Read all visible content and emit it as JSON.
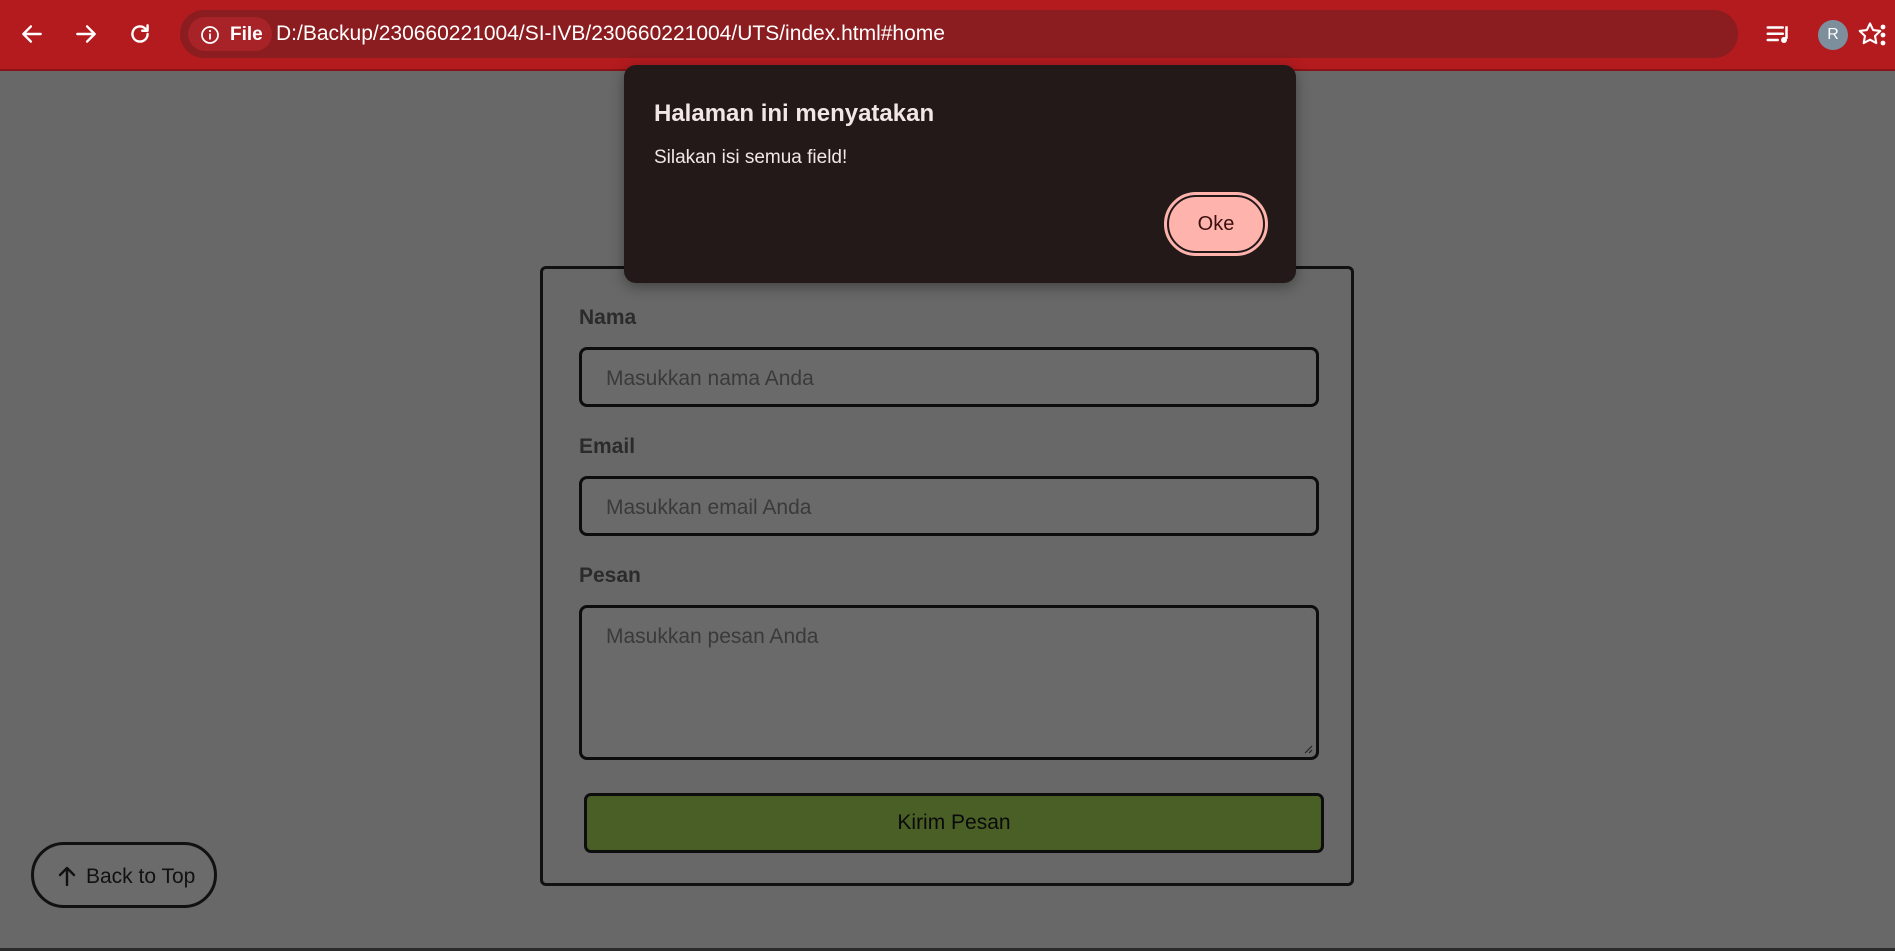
{
  "browser": {
    "site_info_label": "File",
    "url": "D:/Backup/230660221004/SI-IVB/230660221004/UTS/index.html#home",
    "profile_initial": "R",
    "toolbar_color": "#b31b1f"
  },
  "form": {
    "name_label": "Nama",
    "name_placeholder": "Masukkan nama Anda",
    "email_label": "Email",
    "email_placeholder": "Masukkan email Anda",
    "message_label": "Pesan",
    "message_placeholder": "Masukkan pesan Anda",
    "submit_label": "Kirim Pesan",
    "submit_color": "#4a5f26"
  },
  "back_to_top": {
    "label": "Back to Top"
  },
  "alert": {
    "title": "Halaman ini menyatakan",
    "message": "Silakan isi semua field!",
    "ok_label": "Oke",
    "ok_color": "#ffb3ad"
  }
}
